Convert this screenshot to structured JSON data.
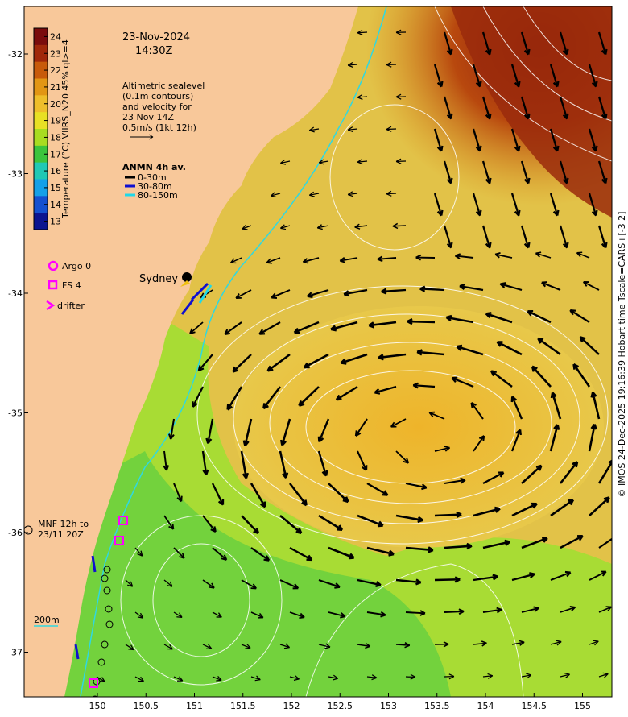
{
  "header": {
    "date": "23-Nov-2024",
    "time": "14:30Z"
  },
  "altimetry_note": {
    "lines": [
      "Altimetric sealevel",
      "(0.1m contours)",
      "and velocity for",
      "23 Nov 14Z",
      "0.5m/s (1kt 12h)"
    ]
  },
  "anmn_legend": {
    "title": "ANMN 4h av.",
    "items": [
      {
        "label": "0-30m",
        "color": "#000000"
      },
      {
        "label": "30-80m",
        "color": "#1010d0"
      },
      {
        "label": "80-150m",
        "color": "#20d8e8"
      }
    ]
  },
  "colorbar": {
    "label": "Temperature (°C) VIIRS_N20 45% ql>=4",
    "min": 13,
    "max": 24,
    "ticks": [
      "24",
      "23",
      "22",
      "21",
      "20",
      "19",
      "18",
      "17",
      "16",
      "15",
      "14",
      "13"
    ],
    "colors": [
      "#7a0c0c",
      "#a0280a",
      "#c85a0a",
      "#e29614",
      "#eebe2a",
      "#e8e024",
      "#a8dc20",
      "#3cc43c",
      "#20c8b4",
      "#14a0e8",
      "#1450d0",
      "#0c1490"
    ]
  },
  "markers_legend": {
    "argo": "Argo 0",
    "fs": "FS 4",
    "drifter": "drifter",
    "marker_color": "#ff00ff"
  },
  "places": {
    "sydney": "Sydney",
    "mnf_line1": "MNF 12h to",
    "mnf_line2": "23/11 20Z",
    "contour_label": "200m"
  },
  "axes": {
    "x_ticks": [
      "150",
      "150.5",
      "151",
      "151.5",
      "152",
      "152.5",
      "153",
      "153.5",
      "154",
      "154.5",
      "155"
    ],
    "y_ticks": [
      "-32",
      "-33",
      "-34",
      "-35",
      "-36",
      "-37"
    ]
  },
  "credit": "© IMOS 24-Dec-2025 19:16:39 Hobart time Tscale=CARS+[-3 2]",
  "map_data": {
    "lon_range": [
      149.5,
      155.5
    ],
    "lat_range": [
      -37.4,
      -31.6
    ],
    "eddy_center": [
      153.4,
      -35.2
    ],
    "argo_count": 0,
    "fs_count": 4
  }
}
